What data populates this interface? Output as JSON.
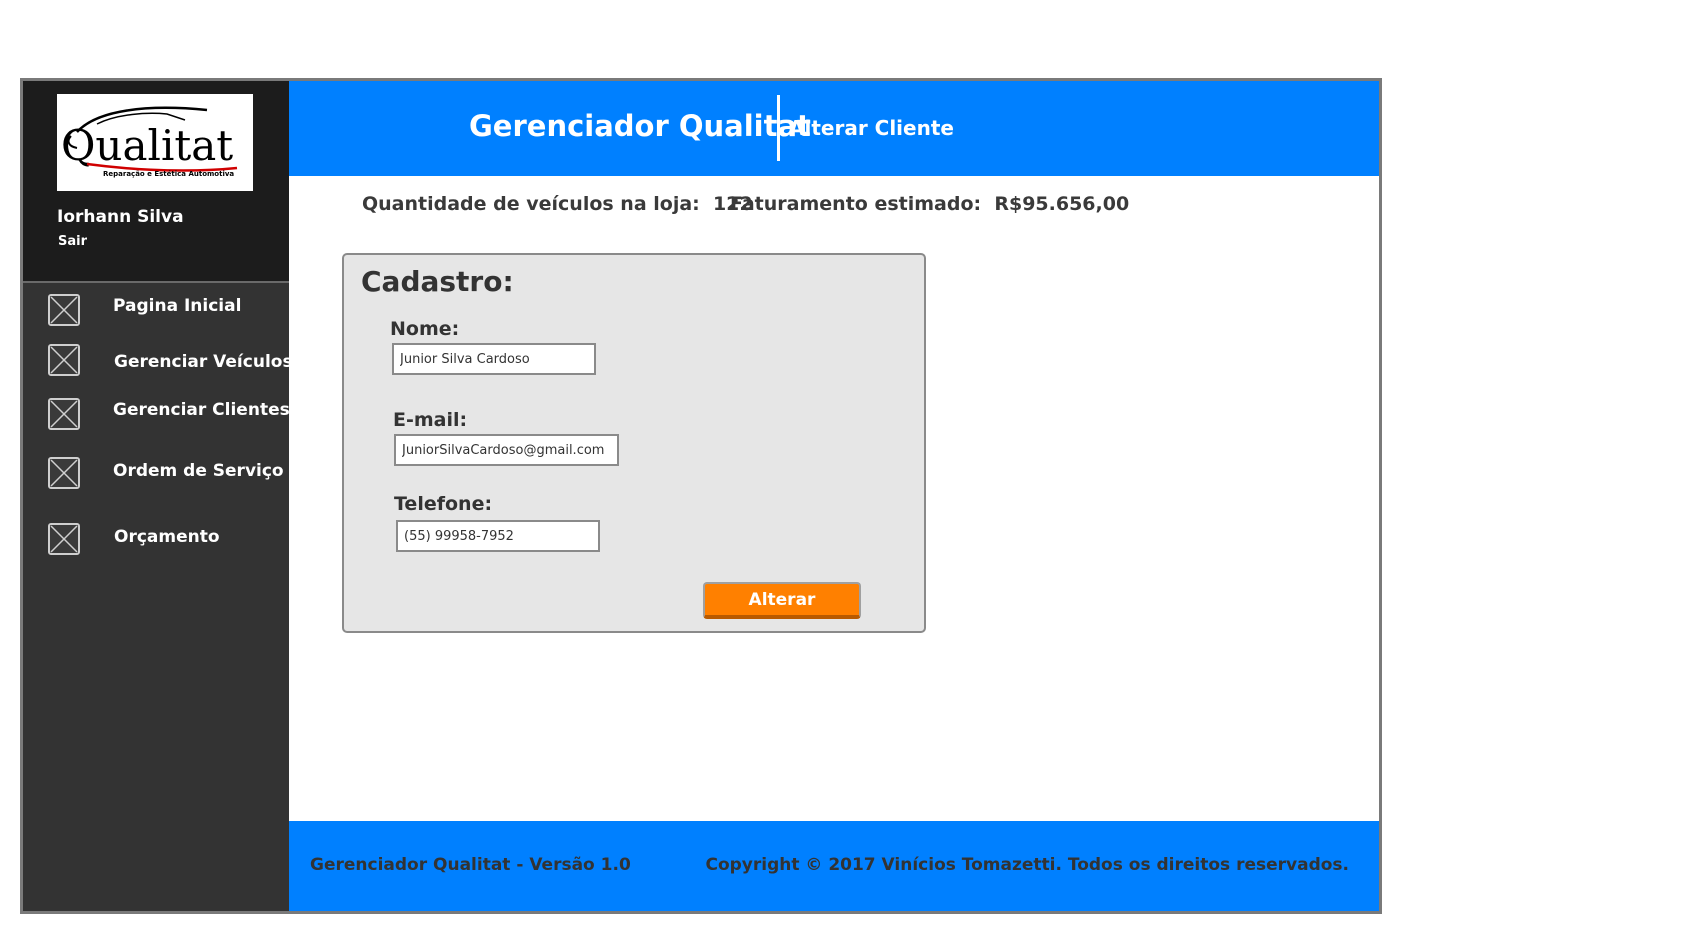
{
  "app": {
    "title": "Gerenciador Qualitat",
    "page_title": "Alterar Cliente"
  },
  "logo": {
    "name": "Qualitat",
    "tagline": "Reparação e Estética Automotiva"
  },
  "user": {
    "name": "Iorhann Silva",
    "logout_label": "Sair"
  },
  "sidebar": {
    "items": [
      {
        "label": "Pagina Inicial",
        "icon": "image-placeholder-icon"
      },
      {
        "label": "Gerenciar Veículos",
        "icon": "image-placeholder-icon"
      },
      {
        "label": "Gerenciar Clientes",
        "icon": "image-placeholder-icon"
      },
      {
        "label": "Ordem de Serviço",
        "icon": "image-placeholder-icon"
      },
      {
        "label": "Orçamento",
        "icon": "image-placeholder-icon"
      }
    ]
  },
  "stats": {
    "vehicles_label": "Quantidade de veículos na loja:",
    "vehicles_value": "122",
    "revenue_label": "Faturamento estimado:",
    "revenue_value": "R$95.656,00"
  },
  "form": {
    "title": "Cadastro:",
    "name_label": "Nome:",
    "name_value": "Junior Silva Cardoso",
    "email_label": "E-mail:",
    "email_value": "JuniorSilvaCardoso@gmail.com",
    "phone_label": "Telefone:",
    "phone_value": "(55) 99958-7952",
    "submit_label": "Alterar"
  },
  "footer": {
    "version": "Gerenciador Qualitat - Versão 1.0",
    "copyright": "Copyright © 2017 Vinícios Tomazetti. Todos os direitos reservados."
  },
  "colors": {
    "header": "#0080ff",
    "sidebar": "#333333",
    "profile": "#1c1c1c",
    "button": "#ff8000",
    "panel": "#e6e6e6"
  }
}
